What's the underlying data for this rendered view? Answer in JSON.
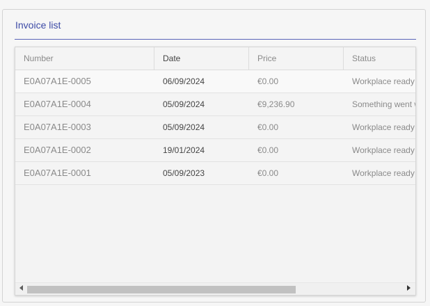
{
  "panel": {
    "title": "Invoice list"
  },
  "grid": {
    "columns": [
      "Number",
      "Date",
      "Price",
      "Status"
    ],
    "rows": [
      {
        "number": "E0A07A1E-0005",
        "date": "06/09/2024",
        "price": "€0.00",
        "status": "Workplace ready"
      },
      {
        "number": "E0A07A1E-0004",
        "date": "05/09/2024",
        "price": "€9,236.90",
        "status": "Something went wrong"
      },
      {
        "number": "E0A07A1E-0003",
        "date": "05/09/2024",
        "price": "€0.00",
        "status": "Workplace ready"
      },
      {
        "number": "E0A07A1E-0002",
        "date": "19/01/2024",
        "price": "€0.00",
        "status": "Workplace ready"
      },
      {
        "number": "E0A07A1E-0001",
        "date": "05/09/2023",
        "price": "€0.00",
        "status": "Workplace ready"
      }
    ]
  },
  "scrollbar": {
    "left_icon": "triangle-left-icon",
    "right_icon": "triangle-right-icon",
    "position_fraction": 0.0,
    "visible_fraction": 0.7
  }
}
